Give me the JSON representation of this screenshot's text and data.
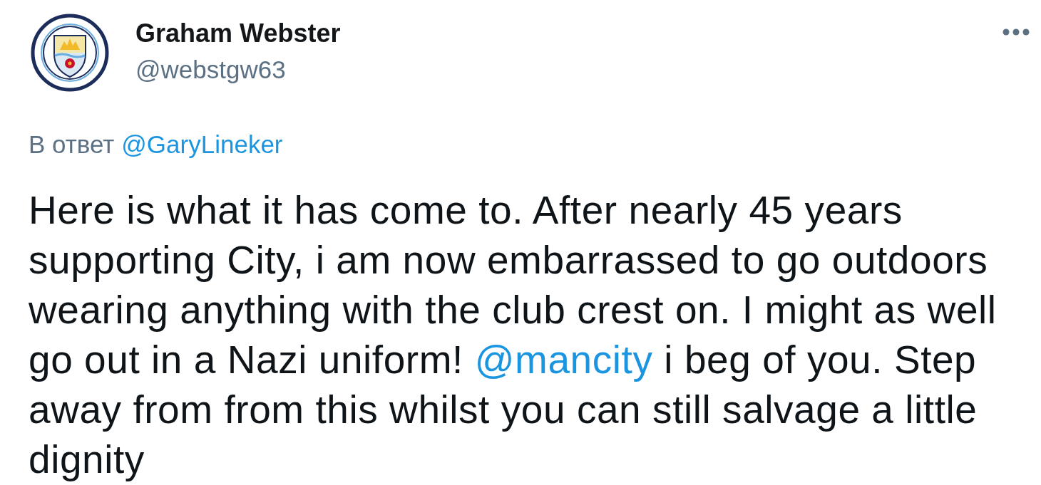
{
  "tweet": {
    "author": {
      "name": "Graham Webster",
      "handle": "@webstgw63"
    },
    "reply_to": {
      "label": "В ответ",
      "mention": "@GaryLineker"
    },
    "body": [
      {
        "kind": "text",
        "text": "Here is what it has come to. After nearly 45 years supporting City, i am now embarrassed to go outdoors wearing anything with the club crest on. I might as well go out in a Nazi uniform! "
      },
      {
        "kind": "mention",
        "text": "@mancity"
      },
      {
        "kind": "text",
        "text": " i beg of you. Step away from from this whilst you can still salvage a little dignity"
      }
    ]
  }
}
